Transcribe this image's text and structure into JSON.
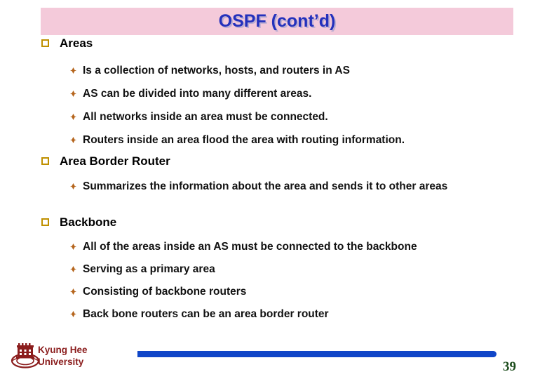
{
  "slide": {
    "title": "OSPF (cont’d)",
    "title_color": "#2431bc",
    "title_band_color": "#f4cada",
    "bullet_square_color": "#bf9000",
    "bullet_diamond_color": "#b5651d"
  },
  "content": {
    "sections": [
      {
        "heading": "Areas",
        "items": [
          "Is a collection of networks, hosts, and routers in AS",
          "AS can be divided into many different areas.",
          "All networks inside an area must be connected.",
          "Routers inside an area flood the area with routing information."
        ]
      },
      {
        "heading": "Area Border Router",
        "items": [
          "Summarizes the information about the area and sends it to other areas"
        ]
      },
      {
        "heading": "Backbone",
        "items": [
          "All of the areas inside an AS must be connected to the backbone",
          "Serving as a primary area",
          "Consisting of backbone routers",
          "Back bone routers can be an area border router"
        ]
      }
    ]
  },
  "footer": {
    "organization_line1": "Kyung Hee",
    "organization_line2": "University",
    "organization_color": "#8b1d1d",
    "rule_color": "#1046c8",
    "page_number": "39",
    "page_number_color": "#1d4d1d"
  }
}
